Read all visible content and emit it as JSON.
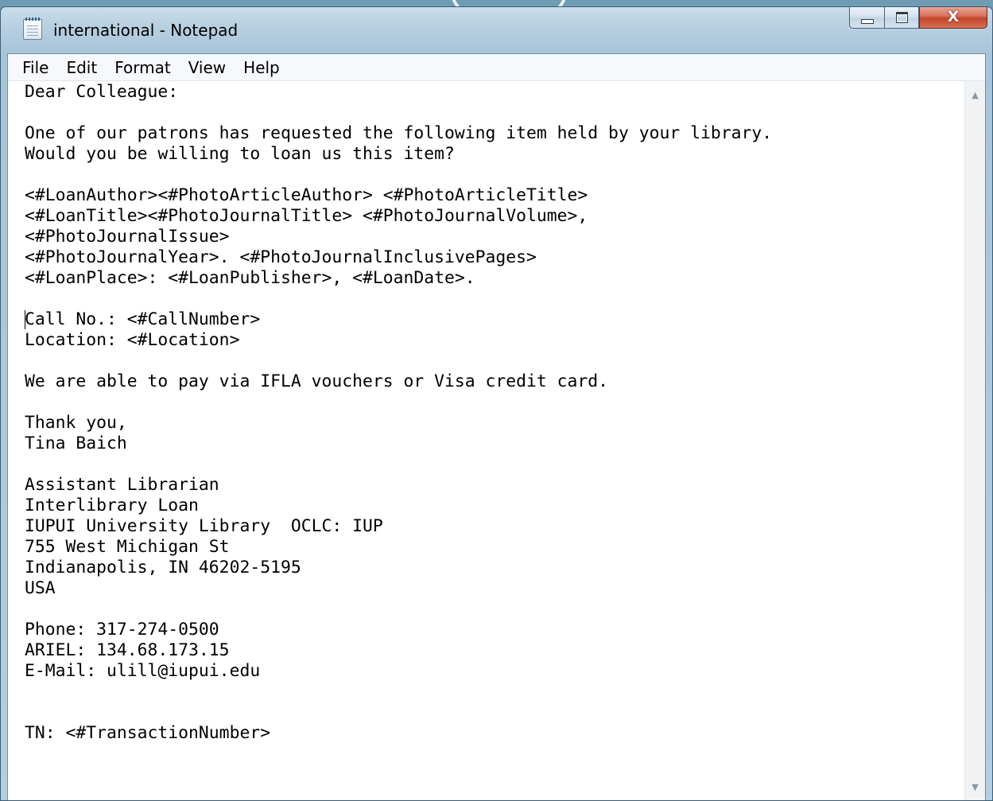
{
  "window": {
    "title": "international - Notepad",
    "icon": "notepad-icon"
  },
  "caption_buttons": {
    "minimize_icon": "minimize-icon",
    "maximize_icon": "maximize-icon",
    "close_label": "X"
  },
  "menu": {
    "items": [
      {
        "label": "File"
      },
      {
        "label": "Edit"
      },
      {
        "label": "Format"
      },
      {
        "label": "View"
      },
      {
        "label": "Help"
      }
    ]
  },
  "document": {
    "text": "Dear Colleague:\n\nOne of our patrons has requested the following item held by your library.\nWould you be willing to loan us this item?\n\n<#LoanAuthor><#PhotoArticleAuthor> <#PhotoArticleTitle>\n<#LoanTitle><#PhotoJournalTitle> <#PhotoJournalVolume>,\n<#PhotoJournalIssue>\n<#PhotoJournalYear>. <#PhotoJournalInclusivePages>\n<#LoanPlace>: <#LoanPublisher>, <#LoanDate>.\n\nCall No.: <#CallNumber>\nLocation: <#Location>\n\nWe are able to pay via IFLA vouchers or Visa credit card.\n\nThank you,\nTina Baich\n\nAssistant Librarian\nInterlibrary Loan\nIUPUI University Library  OCLC: IUP\n755 West Michigan St\nIndianapolis, IN 46202-5195\nUSA\n\nPhone: 317-274-0500\nARIEL: 134.68.173.15\nE-Mail: ulill@iupui.edu\n\n\nTN: <#TransactionNumber>"
  },
  "scrollbar": {
    "up_arrow": "▲",
    "down_arrow": "▼"
  },
  "colors": {
    "frame": "#b7cfe1",
    "close_button": "#c4452b",
    "editor_background": "#ffffff"
  }
}
